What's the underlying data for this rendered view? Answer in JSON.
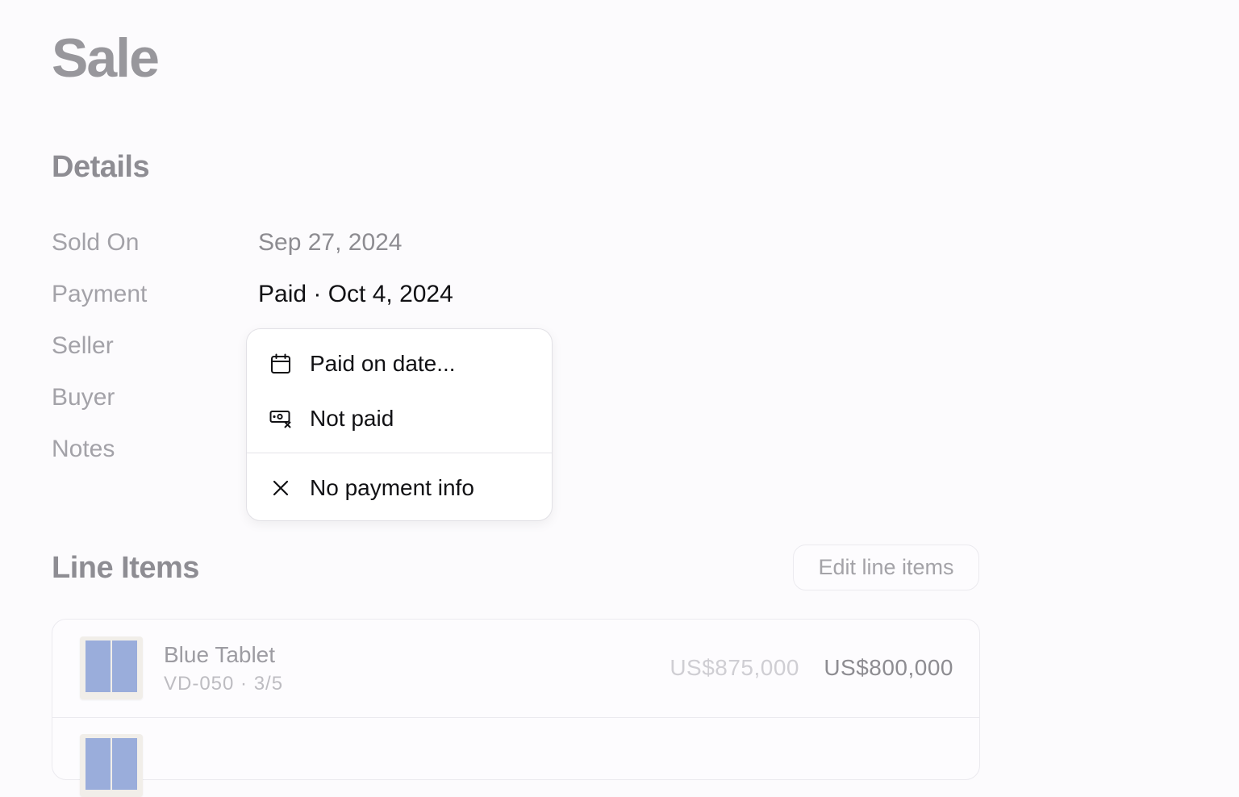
{
  "page": {
    "title": "Sale"
  },
  "details": {
    "title": "Details",
    "fields": [
      {
        "label": "Sold On",
        "value": "Sep 27, 2024"
      },
      {
        "label": "Payment",
        "value": "Paid · Oct 4, 2024"
      },
      {
        "label": "Seller"
      },
      {
        "label": "Buyer"
      },
      {
        "label": "Notes"
      }
    ]
  },
  "payment_menu": {
    "items": [
      {
        "label": "Paid on date...",
        "icon": "calendar-icon"
      },
      {
        "label": "Not paid",
        "icon": "money-off-icon"
      },
      {
        "label": "No payment info",
        "icon": "close-icon"
      }
    ]
  },
  "line_items": {
    "title": "Line Items",
    "edit_label": "Edit line items",
    "items": [
      {
        "name": "Blue Tablet",
        "sku": "VD-050 · 3/5",
        "original_price": "US$875,000",
        "price": "US$800,000",
        "thumb_color": "#9aaddb"
      }
    ]
  }
}
